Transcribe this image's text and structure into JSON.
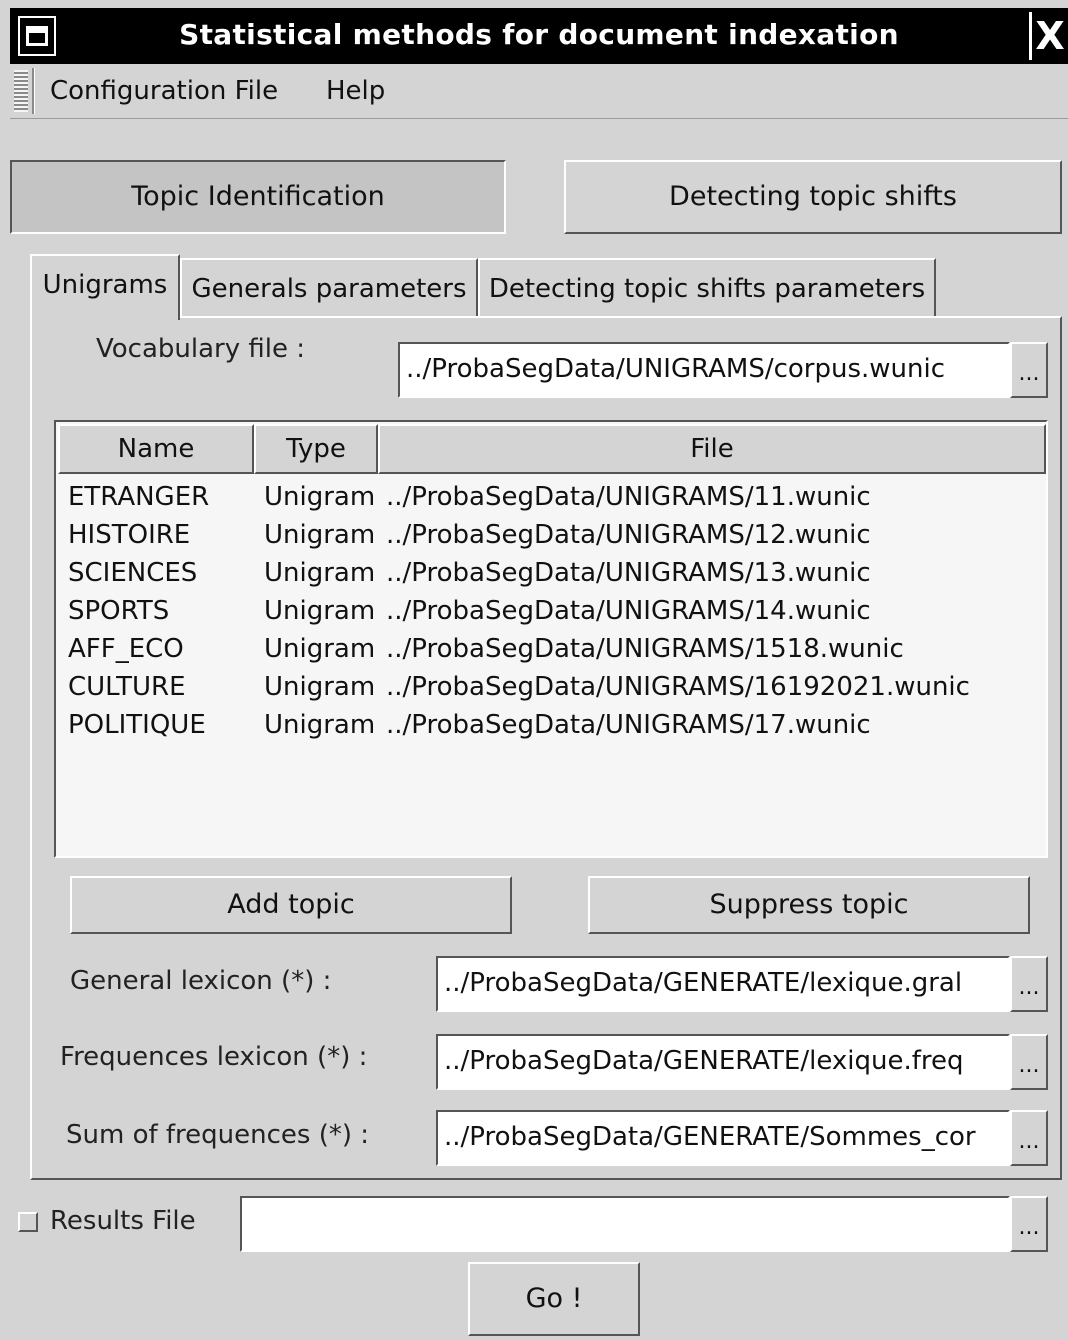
{
  "window": {
    "title": "Statistical methods for document indexation",
    "close_glyph": "X"
  },
  "menu": {
    "items": [
      "Configuration File",
      "Help"
    ]
  },
  "mode_buttons": {
    "topic_identification": "Topic Identification",
    "detecting_topic_shifts": "Detecting topic shifts"
  },
  "tabs": [
    "Unigrams",
    "Generals parameters",
    "Detecting topic shifts parameters"
  ],
  "vocabulary": {
    "label": "Vocabulary file :",
    "value": "../ProbaSegData/UNIGRAMS/corpus.wunic"
  },
  "topics_table": {
    "headers": [
      "Name",
      "Type",
      "File"
    ],
    "rows": [
      [
        "ETRANGER",
        "Unigram",
        "../ProbaSegData/UNIGRAMS/11.wunic"
      ],
      [
        "HISTOIRE",
        "Unigram",
        "../ProbaSegData/UNIGRAMS/12.wunic"
      ],
      [
        "SCIENCES",
        "Unigram",
        "../ProbaSegData/UNIGRAMS/13.wunic"
      ],
      [
        "SPORTS",
        "Unigram",
        "../ProbaSegData/UNIGRAMS/14.wunic"
      ],
      [
        "AFF_ECO",
        "Unigram",
        "../ProbaSegData/UNIGRAMS/1518.wunic"
      ],
      [
        "CULTURE",
        "Unigram",
        "../ProbaSegData/UNIGRAMS/16192021.wunic"
      ],
      [
        "POLITIQUE",
        "Unigram",
        "../ProbaSegData/UNIGRAMS/17.wunic"
      ]
    ]
  },
  "buttons": {
    "add_topic": "Add topic",
    "suppress_topic": "Suppress topic",
    "go": "Go !",
    "browse": "..."
  },
  "general_lexicon": {
    "label": "General lexicon (*) :",
    "value": "../ProbaSegData/GENERATE/lexique.gral"
  },
  "frequences_lexicon": {
    "label": "Frequences lexicon (*) :",
    "value": "../ProbaSegData/GENERATE/lexique.freq"
  },
  "sum_of_frequences": {
    "label": "Sum of frequences (*) :",
    "value": "../ProbaSegData/GENERATE/Sommes_cor"
  },
  "results_file": {
    "label": "Results File",
    "value": "",
    "checked": false
  }
}
